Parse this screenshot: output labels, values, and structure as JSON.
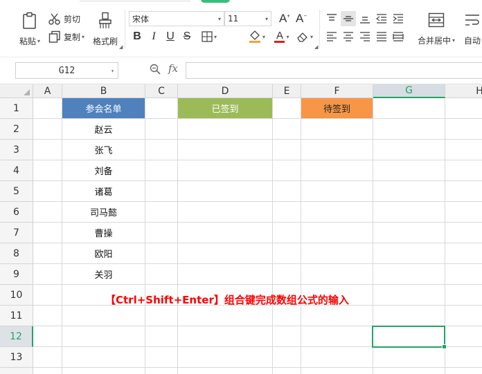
{
  "ribbon": {
    "clipboard": {
      "paste": "粘贴",
      "cut": "剪切",
      "copy": "复制",
      "format_painter": "格式刷"
    },
    "font": {
      "family": "宋体",
      "size": "11"
    },
    "alignment": {
      "merge_center": "合并居中",
      "auto_wrap": "自动"
    }
  },
  "formula_bar": {
    "cell_ref": "G12",
    "fx": "fx",
    "formula": ""
  },
  "sheet": {
    "columns": [
      "A",
      "B",
      "C",
      "D",
      "E",
      "F",
      "G",
      "H"
    ],
    "active_column": "G",
    "rows": [
      "1",
      "2",
      "3",
      "4",
      "5",
      "6",
      "7",
      "8",
      "9",
      "10",
      "11",
      "12",
      "13"
    ],
    "active_row": "12",
    "b1": "参会名单",
    "d1": "已签到",
    "f1": "待签到",
    "names": [
      "赵云",
      "张飞",
      "刘备",
      "诸葛",
      "司马懿",
      "曹操",
      "欧阳",
      "关羽"
    ],
    "note": "【Ctrl+Shift+Enter】组合键完成数组公式的输入"
  },
  "colors": {
    "header_blue": "#4f81bd",
    "header_green": "#9bbb59",
    "header_orange": "#f79646",
    "note_red": "#ff0000",
    "selection_green": "#21a366"
  }
}
